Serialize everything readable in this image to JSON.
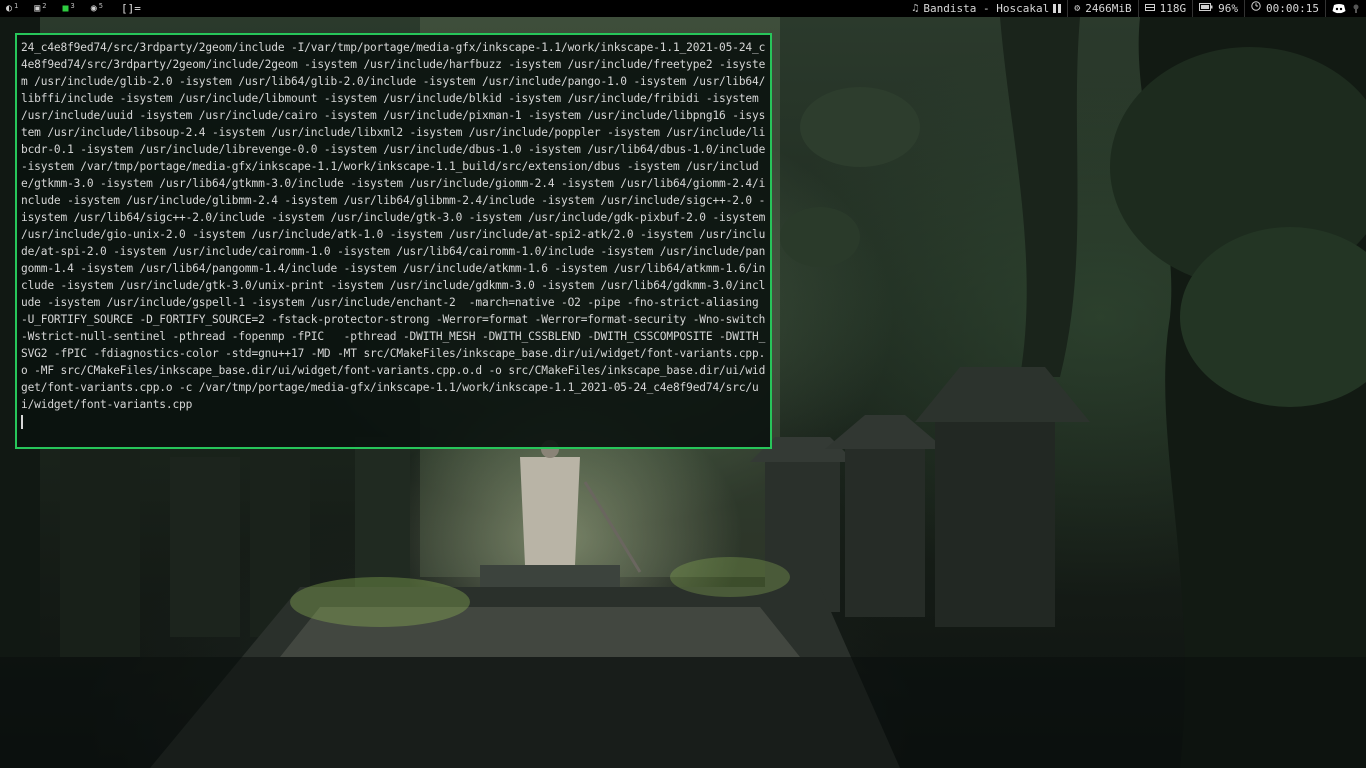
{
  "topbar": {
    "workspaces": [
      {
        "glyph": "◐",
        "num": "1",
        "icon": "terminal-workspace-icon"
      },
      {
        "glyph": "▣",
        "num": "2",
        "icon": "chat-workspace-icon"
      },
      {
        "glyph": "■",
        "num": "3",
        "icon": "active-workspace-icon",
        "active": true
      },
      {
        "glyph": "◉",
        "num": "5",
        "icon": "media-workspace-icon"
      }
    ],
    "layout": "[]=",
    "music": "Bandista - Hoscakal",
    "music_icon": "music-note-icon",
    "memory": "2466MiB",
    "disk": "118G",
    "battery": "96%",
    "clock": "00:00:15",
    "accent": "#27c55a"
  },
  "terminal": {
    "output": "24_c4e8f9ed74/src/3rdparty/2geom/include -I/var/tmp/portage/media-gfx/inkscape-1.1/work/inkscape-1.1_2021-05-24_c4e8f9ed74/src/3rdparty/2geom/include/2geom -isystem /usr/include/harfbuzz -isystem /usr/include/freetype2 -isystem /usr/include/glib-2.0 -isystem /usr/lib64/glib-2.0/include -isystem /usr/include/pango-1.0 -isystem /usr/lib64/libffi/include -isystem /usr/include/libmount -isystem /usr/include/blkid -isystem /usr/include/fribidi -isystem /usr/include/uuid -isystem /usr/include/cairo -isystem /usr/include/pixman-1 -isystem /usr/include/libpng16 -isystem /usr/include/libsoup-2.4 -isystem /usr/include/libxml2 -isystem /usr/include/poppler -isystem /usr/include/libcdr-0.1 -isystem /usr/include/librevenge-0.0 -isystem /usr/include/dbus-1.0 -isystem /usr/lib64/dbus-1.0/include -isystem /var/tmp/portage/media-gfx/inkscape-1.1/work/inkscape-1.1_build/src/extension/dbus -isystem /usr/include/gtkmm-3.0 -isystem /usr/lib64/gtkmm-3.0/include -isystem /usr/include/giomm-2.4 -isystem /usr/lib64/giomm-2.4/include -isystem /usr/include/glibmm-2.4 -isystem /usr/lib64/glibmm-2.4/include -isystem /usr/include/sigc++-2.0 -isystem /usr/lib64/sigc++-2.0/include -isystem /usr/include/gtk-3.0 -isystem /usr/include/gdk-pixbuf-2.0 -isystem /usr/include/gio-unix-2.0 -isystem /usr/include/atk-1.0 -isystem /usr/include/at-spi2-atk/2.0 -isystem /usr/include/at-spi-2.0 -isystem /usr/include/cairomm-1.0 -isystem /usr/lib64/cairomm-1.0/include -isystem /usr/include/pangomm-1.4 -isystem /usr/lib64/pangomm-1.4/include -isystem /usr/include/atkmm-1.6 -isystem /usr/lib64/atkmm-1.6/include -isystem /usr/include/gtk-3.0/unix-print -isystem /usr/include/gdkmm-3.0 -isystem /usr/lib64/gdkmm-3.0/include -isystem /usr/include/gspell-1 -isystem /usr/include/enchant-2  -march=native -O2 -pipe -fno-strict-aliasing -U_FORTIFY_SOURCE -D_FORTIFY_SOURCE=2 -fstack-protector-strong -Werror=format -Werror=format-security -Wno-switch -Wstrict-null-sentinel -pthread -fopenmp -fPIC   -pthread -DWITH_MESH -DWITH_CSSBLEND -DWITH_CSSCOMPOSITE -DWITH_SVG2 -fPIC -fdiagnostics-color -std=gnu++17 -MD -MT src/CMakeFiles/inkscape_base.dir/ui/widget/font-variants.cpp.o -MF src/CMakeFiles/inkscape_base.dir/ui/widget/font-variants.cpp.o.d -o src/CMakeFiles/inkscape_base.dir/ui/widget/font-variants.cpp.o -c /var/tmp/portage/media-gfx/inkscape-1.1/work/inkscape-1.1_2021-05-24_c4e8f9ed74/src/ui/widget/font-variants.cpp"
  }
}
